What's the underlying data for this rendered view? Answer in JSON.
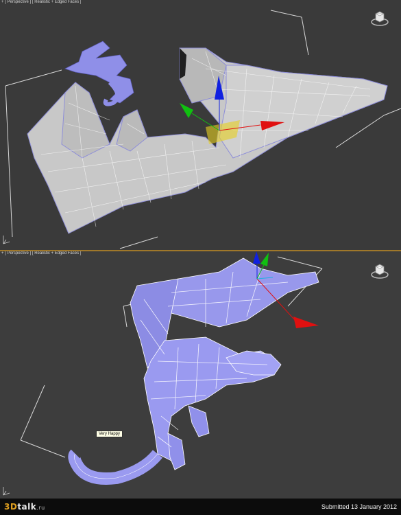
{
  "viewport_top": {
    "label_plus": "+",
    "label_view": "[ Perspective ]",
    "label_shading": "[ Realistic + Edged Faces ]"
  },
  "viewport_bottom": {
    "label_plus": "+",
    "label_view": "[ Perspective ]",
    "label_shading": "[ Realistic + Edged Faces ]"
  },
  "tooltip": "Very Happy",
  "footer": {
    "logo_prefix": "3D",
    "logo_name": "talk",
    "logo_domain": ".ru",
    "submitted": "Submitted 13 January 2012"
  },
  "colors": {
    "mesh_terrain": "#c8c8c8",
    "mesh_dragon": "#8f8fe8",
    "gizmo_x": "#e01010",
    "gizmo_y": "#10c010",
    "gizmo_z": "#1020e0"
  }
}
